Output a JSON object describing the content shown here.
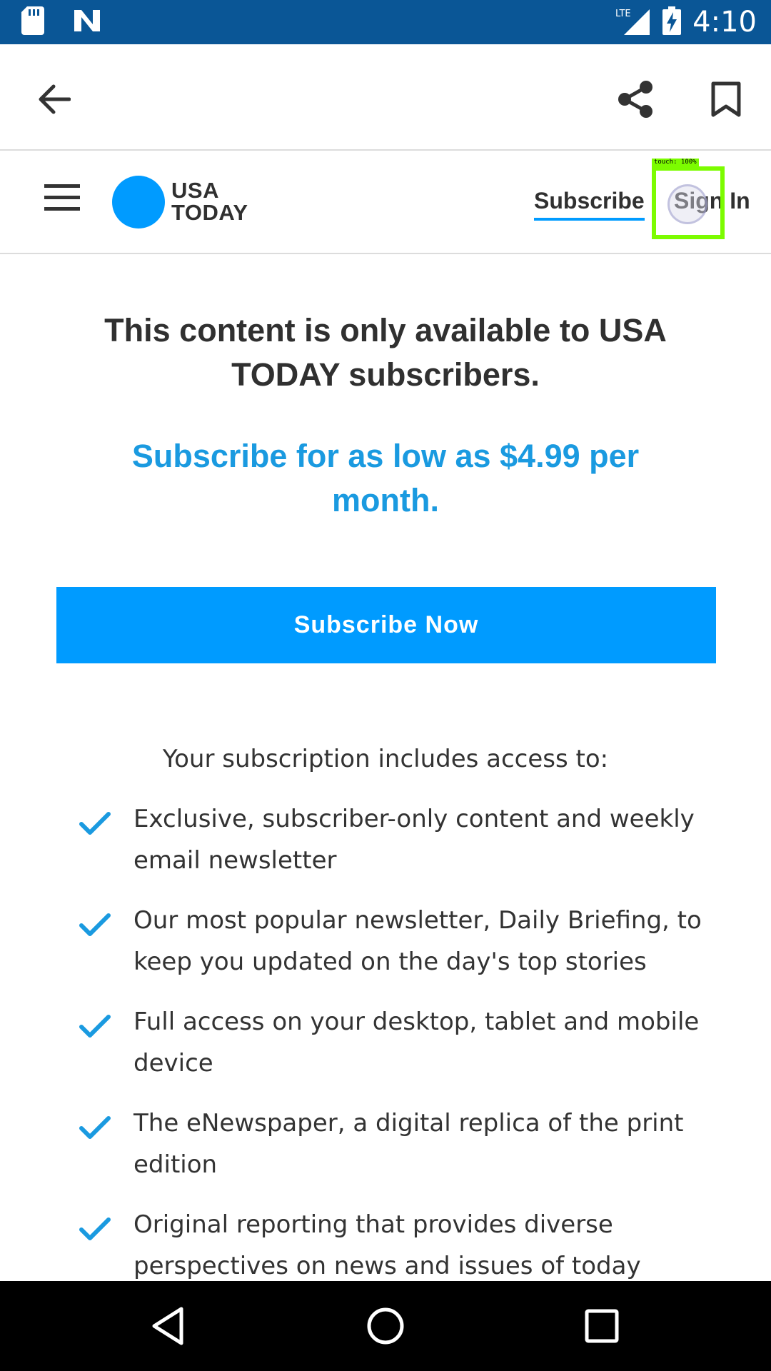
{
  "status_bar": {
    "time": "4:10",
    "network": "LTE",
    "background": "#0a5696",
    "icons": [
      "sd-card-icon",
      "n-notification-icon",
      "lte-signal-icon",
      "battery-charging-icon"
    ]
  },
  "toolbar": {
    "icons": [
      "back-arrow-icon",
      "share-icon",
      "bookmark-icon"
    ]
  },
  "header": {
    "logo_line1": "USA",
    "logo_line2": "TODAY",
    "subscribe_label": "Subscribe",
    "signin_label": "Sign In",
    "accent": "#009bff"
  },
  "touch_indicator": {
    "label": "touch: 100%"
  },
  "main": {
    "headline": "This content is only available to USA TODAY subscribers.",
    "promo": "Subscribe for as low as $4.99 per month.",
    "cta_label": "Subscribe Now",
    "includes_title": "Your subscription includes access to:",
    "benefits": [
      "Exclusive, subscriber-only content and weekly email newsletter",
      "Our most popular newsletter, Daily Briefing, to keep you updated on the day's top stories",
      "Full access on your desktop, tablet and mobile device",
      "The eNewspaper, a digital replica of the print edition",
      "Original reporting that provides diverse perspectives on news and issues of today"
    ]
  },
  "nav_bar": {
    "icons": [
      "nav-back-icon",
      "nav-home-icon",
      "nav-recents-icon"
    ]
  }
}
